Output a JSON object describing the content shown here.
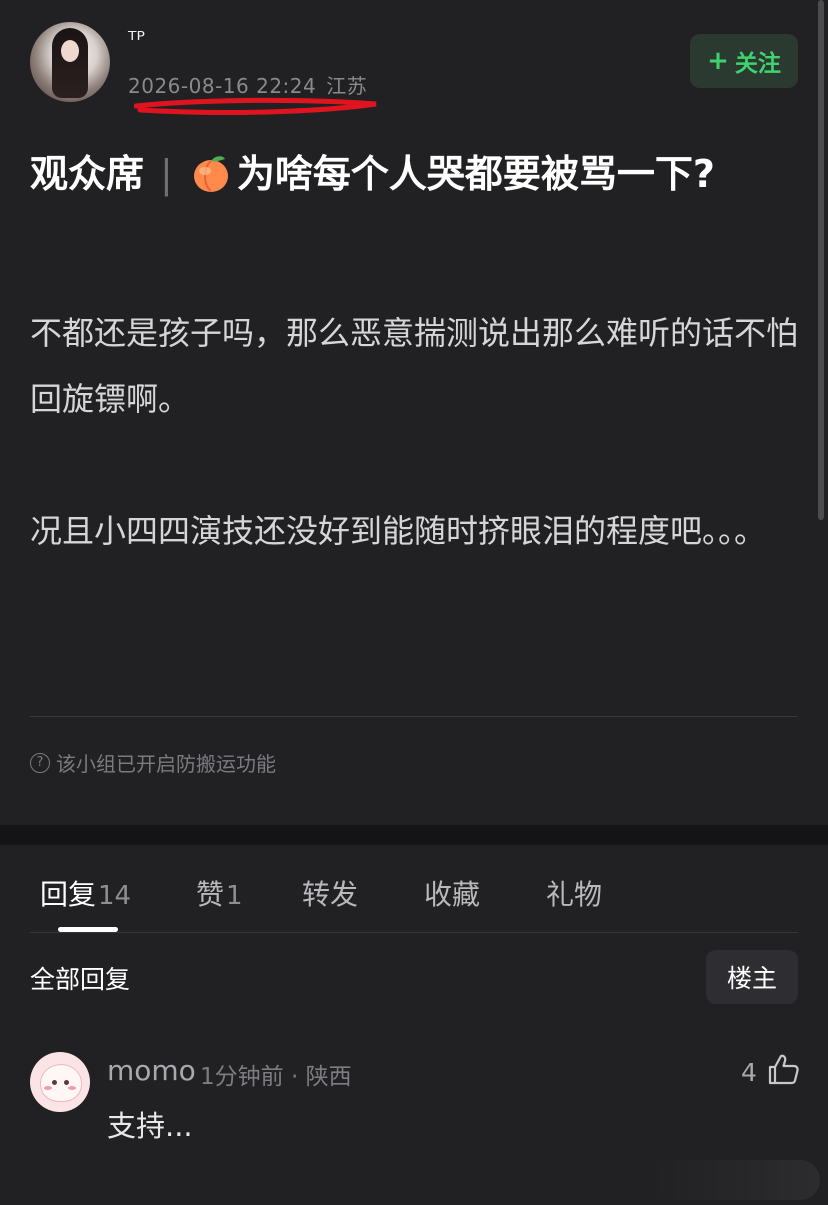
{
  "post": {
    "author": "ᵀᴾ",
    "date": "2026-08-16 22:24",
    "region": "江苏",
    "follow_label": "关注",
    "title_group": "观众席",
    "title_separator": "|",
    "title_text": "为啥每个人哭都要被骂一下?",
    "body_paragraph_1": "不都还是孩子吗，那么恶意揣测说出那么难听的话不怕回旋镖啊。",
    "body_paragraph_2": "况且小四四演技还没好到能随时挤眼泪的程度吧。。。",
    "notice": "该小组已开启防搬运功能"
  },
  "tabs": [
    {
      "label": "回复",
      "count": "14"
    },
    {
      "label": "赞",
      "count": "1"
    },
    {
      "label": "转发",
      "count": ""
    },
    {
      "label": "收藏",
      "count": ""
    },
    {
      "label": "礼物",
      "count": ""
    }
  ],
  "replies": {
    "header": "全部回复",
    "filter_label": "楼主",
    "items": [
      {
        "author": "momo",
        "time": "1分钟前",
        "region": "陕西",
        "text": "支持...",
        "likes": "4"
      }
    ]
  },
  "colors": {
    "background": "#212124",
    "accent_green": "#3fd36e",
    "annotation_red": "#e0141e"
  },
  "icons": [
    "plus-icon",
    "peach-emoji-icon",
    "help-circle-icon",
    "thumbs-up-icon"
  ]
}
